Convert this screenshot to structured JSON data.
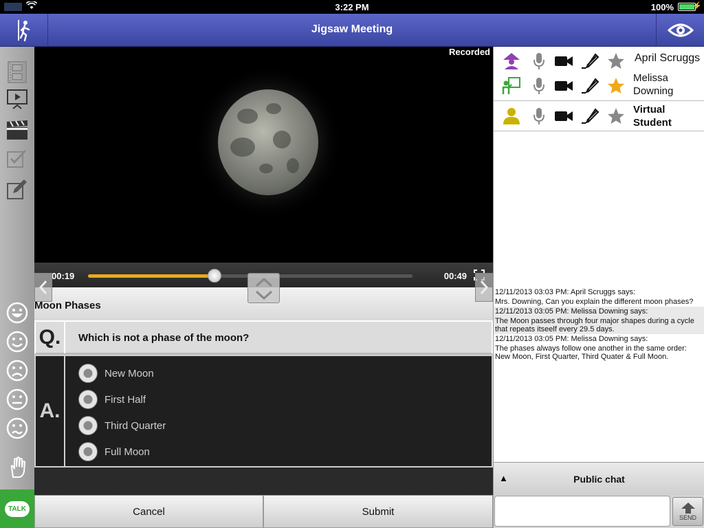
{
  "status_bar": {
    "time": "3:22 PM",
    "battery": "100%"
  },
  "header": {
    "title": "Jigsaw Meeting"
  },
  "video": {
    "recorded_label": "Recorded",
    "current_time": "00:19",
    "total_time": "00:49",
    "progress": 0.39
  },
  "quiz": {
    "title": "Moon Phases",
    "question_letter": "Q.",
    "question": "Which is not a phase of the moon?",
    "answer_letter": "A.",
    "options": [
      "New Moon",
      "First Half",
      "Third Quarter",
      "Full Moon"
    ],
    "cancel_label": "Cancel",
    "submit_label": "Submit"
  },
  "participants": [
    {
      "name": "April Scruggs",
      "role_icon": "presenter-icon",
      "role_color": "#8e44ad",
      "star_color": "#888888",
      "bold": false
    },
    {
      "name": "Melissa Downing",
      "role_icon": "teacher-icon",
      "role_color": "#3aa73a",
      "star_color": "#f0a818",
      "bold": false
    },
    {
      "name": "Virtual Student",
      "role_icon": "student-icon",
      "role_color": "#c9b200",
      "star_color": "#888888",
      "bold": true
    }
  ],
  "chat": {
    "messages": [
      {
        "header": "12/11/2013 03:03 PM: April Scruggs says:",
        "text": "Mrs. Downing, Can you explain the different moon phases?"
      },
      {
        "header": "12/11/2013 03:05 PM: Melissa Downing says:",
        "text": "The Moon passes through four major shapes during a cycle that repeats itseelf every 29.5 days."
      },
      {
        "header": "12/11/2013 03:05 PM: Melissa Downing says:",
        "text": "The phases always follow one another in the same order: New Moon, First Quarter, Third Quater & Full Moon."
      }
    ],
    "bar_label": "Public chat",
    "input_value": "",
    "send_label": "SEND"
  },
  "left_toolbar": {
    "talk_label": "TALK"
  }
}
